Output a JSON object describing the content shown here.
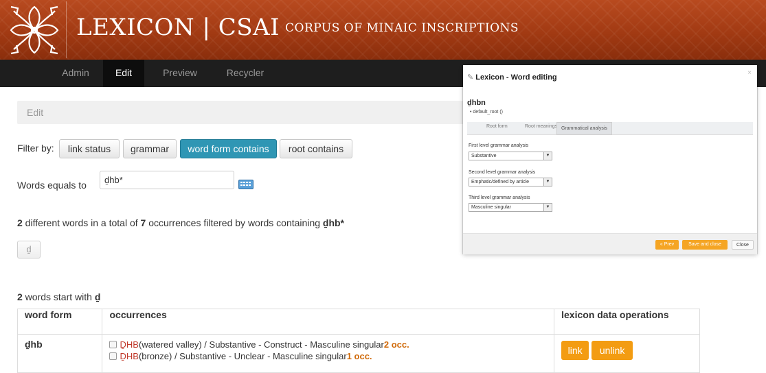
{
  "header": {
    "title": "LEXICON | CSAI",
    "subtitle": "CORPUS OF MINAIC INSCRIPTIONS",
    "logo_icon": "flower-ornament-icon",
    "colors": {
      "header_bg": "#a23a13",
      "nav_bg": "#1e1e1e"
    }
  },
  "nav": {
    "items": [
      {
        "label": "Admin",
        "active": false
      },
      {
        "label": "Edit",
        "active": true
      },
      {
        "label": "Preview",
        "active": false
      },
      {
        "label": "Recycler",
        "active": false
      }
    ]
  },
  "breadcrumb": {
    "label": "Edit"
  },
  "filter": {
    "label": "Filter by:",
    "buttons": [
      {
        "label": "link status",
        "active": false
      },
      {
        "label": "grammar",
        "active": false
      },
      {
        "label": "word form contains",
        "active": true
      },
      {
        "label": "root contains",
        "active": false
      }
    ],
    "accent_color": "#2f96b4"
  },
  "search": {
    "label": "Words equals to",
    "value": "ḏhb*",
    "keyboard_icon": "keyboard-icon"
  },
  "summary": {
    "words_count": "2",
    "text1": " different words in a total of ",
    "occ_count": "7",
    "text2": " occurrences filtered by words containing ",
    "query": "ḏhb*"
  },
  "letter_button": {
    "label": "ḏ"
  },
  "letter_summary": {
    "count": "2",
    "text": " words start with ",
    "letter": "ḏ"
  },
  "table": {
    "headers": [
      "word form",
      "occurrences",
      "lexicon data operations"
    ],
    "rows": [
      {
        "word_form": "ḏhb",
        "occurrences": [
          {
            "word": "ḎHB",
            "description": " (watered valley) / Substantive - Construct - Masculine singular ",
            "count": "2 occ."
          },
          {
            "word": "ḎHB",
            "description": " (bronze) / Substantive - Unclear - Masculine singular ",
            "count": "1 occ."
          }
        ],
        "ops": {
          "link": "link",
          "unlink": "unlink"
        }
      }
    ],
    "op_color": "#f39c12"
  },
  "modal": {
    "title": "Lexicon - Word editing",
    "title_icon": "edit-icon",
    "close_icon": "close-icon",
    "word": "ḏhbn",
    "root": "default_root ()",
    "tabs": [
      {
        "label": "Root form",
        "selected": false
      },
      {
        "label": "Root meanings",
        "selected": false
      },
      {
        "label": "Grammatical analysis",
        "selected": true
      }
    ],
    "fields": [
      {
        "label": "First level grammar analysis",
        "value": "Substantive"
      },
      {
        "label": "Second level grammar analysis",
        "value": "Emphatic/defined by article"
      },
      {
        "label": "Third level grammar analysis",
        "value": "Masculine singular"
      }
    ],
    "buttons": {
      "prev": "« Prev",
      "save_close": "Save and close",
      "close": "Close"
    }
  }
}
